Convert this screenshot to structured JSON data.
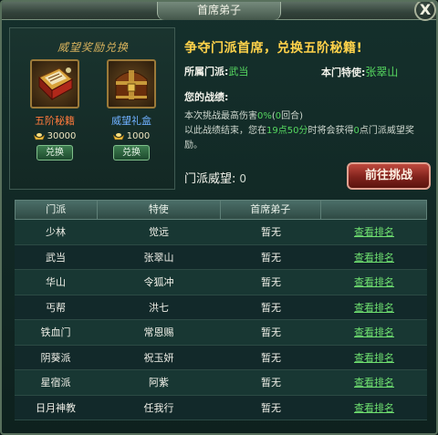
{
  "window": {
    "title": "首席弟子",
    "close_label": "X"
  },
  "rewards": {
    "title": "威望奖励兑换",
    "items": [
      {
        "name": "五阶秘籍",
        "cost": "30000",
        "button": "兑换"
      },
      {
        "name": "威望礼盒",
        "cost": "1000",
        "button": "兑换"
      }
    ]
  },
  "info": {
    "headline": "争夺门派首席，兑换五阶秘籍!",
    "sect_label": "所属门派:",
    "sect_value": "武当",
    "envoy_label": "本门特使:",
    "envoy_value": "张翠山",
    "battle_label": "您的战绩:",
    "battle_line1_pre": "本次挑战最高伤害",
    "battle_line1_pct": "0%",
    "battle_line1_mid": "(",
    "battle_line1_round": "0",
    "battle_line1_post": "回合)",
    "battle_line2_pre": "以此战绩结束，您在",
    "battle_line2_time": "19点50分",
    "battle_line2_mid": "时将会获得",
    "battle_line2_pts": "0",
    "battle_line2_post": "点门派威望奖励。",
    "prestige_label": "门派威望:",
    "prestige_value": "0",
    "challenge_button": "前往挑战"
  },
  "table": {
    "headers": [
      "门派",
      "特使",
      "首席弟子",
      ""
    ],
    "rows": [
      {
        "sect": "少林",
        "envoy": "觉远",
        "disciple": "暂无",
        "action": "查看排名"
      },
      {
        "sect": "武当",
        "envoy": "张翠山",
        "disciple": "暂无",
        "action": "查看排名"
      },
      {
        "sect": "华山",
        "envoy": "令狐冲",
        "disciple": "暂无",
        "action": "查看排名"
      },
      {
        "sect": "丐帮",
        "envoy": "洪七",
        "disciple": "暂无",
        "action": "查看排名"
      },
      {
        "sect": "铁血门",
        "envoy": "常恩赐",
        "disciple": "暂无",
        "action": "查看排名"
      },
      {
        "sect": "阴葵派",
        "envoy": "祝玉妍",
        "disciple": "暂无",
        "action": "查看排名"
      },
      {
        "sect": "星宿派",
        "envoy": "阿紫",
        "disciple": "暂无",
        "action": "查看排名"
      },
      {
        "sect": "日月神教",
        "envoy": "任我行",
        "disciple": "暂无",
        "action": "查看排名"
      }
    ]
  },
  "colors": {
    "accent_gold": "#ffd24a",
    "green_text": "#56d860",
    "link": "#6fe070",
    "challenge_red": "#9b2e25"
  },
  "icons": {
    "book": "secret-book-icon",
    "chest": "gift-chest-icon",
    "coin": "ingot-icon",
    "close": "close-icon"
  }
}
